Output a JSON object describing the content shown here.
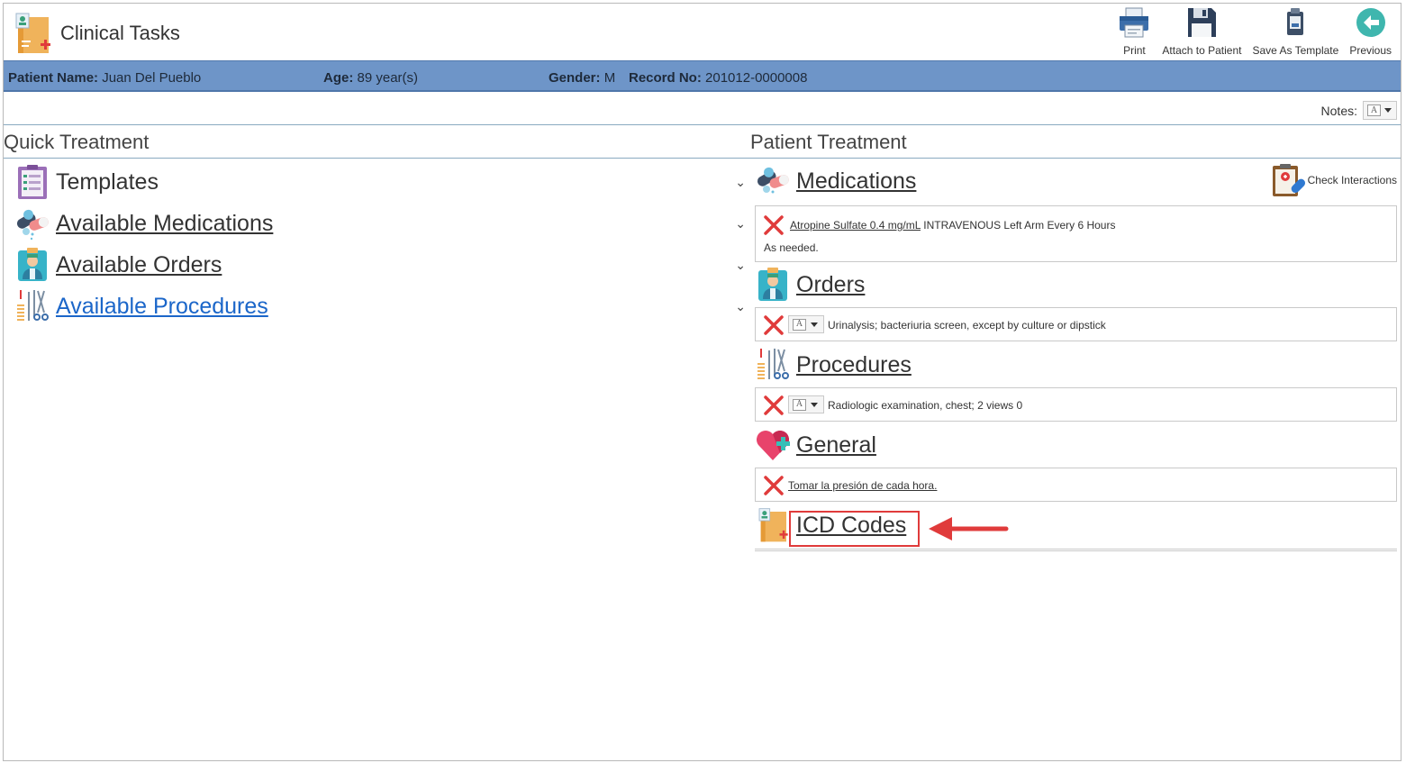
{
  "header": {
    "title": "Clinical Tasks",
    "app_icon": "clinical-chart-icon"
  },
  "toolbar": [
    {
      "label": "Print",
      "icon": "printer-icon"
    },
    {
      "label": "Attach to Patient",
      "icon": "floppy-disk-icon"
    },
    {
      "label": "Save As Template",
      "icon": "template-icon"
    },
    {
      "label": "Previous",
      "icon": "back-arrow-icon"
    }
  ],
  "patient": {
    "name_label": "Patient Name:",
    "name": "Juan Del Pueblo",
    "age_label": "Age:",
    "age": "89 year(s)",
    "gender_label": "Gender:",
    "gender": "M",
    "record_label": "Record No:",
    "record": "201012-0000008",
    "bar_color": "#6e95c8"
  },
  "notes": {
    "label": "Notes:"
  },
  "quick_treatment": {
    "title": "Quick Treatment",
    "items": [
      {
        "label": "Templates",
        "icon": "clipboard-list-icon"
      },
      {
        "label": "Available Medications",
        "icon": "pills-icon"
      },
      {
        "label": "Available Orders",
        "icon": "doctor-icon"
      },
      {
        "label": "Available Procedures",
        "icon": "surgical-tools-icon"
      }
    ]
  },
  "patient_treatment": {
    "title": "Patient Treatment",
    "check_interactions": "Check Interactions",
    "medications": {
      "label": "Medications",
      "entry_drug": "Atropine Sulfate  0.4 mg/mL",
      "entry_detail": " INTRAVENOUS Left Arm Every 6 Hours",
      "entry_note": "As needed."
    },
    "orders": {
      "label": "Orders",
      "entry": "Urinalysis; bacteriuria screen, except by culture or dipstick"
    },
    "procedures": {
      "label": "Procedures",
      "entry": "Radiologic examination, chest; 2 views 0"
    },
    "general": {
      "label": "General",
      "entry": "Tomar la presión de cada hora."
    },
    "icd": {
      "label": "ICD Codes"
    }
  },
  "colors": {
    "highlight": "#e03b3b",
    "link_blue": "#1b66c9",
    "remove_red": "#e03b3b"
  }
}
